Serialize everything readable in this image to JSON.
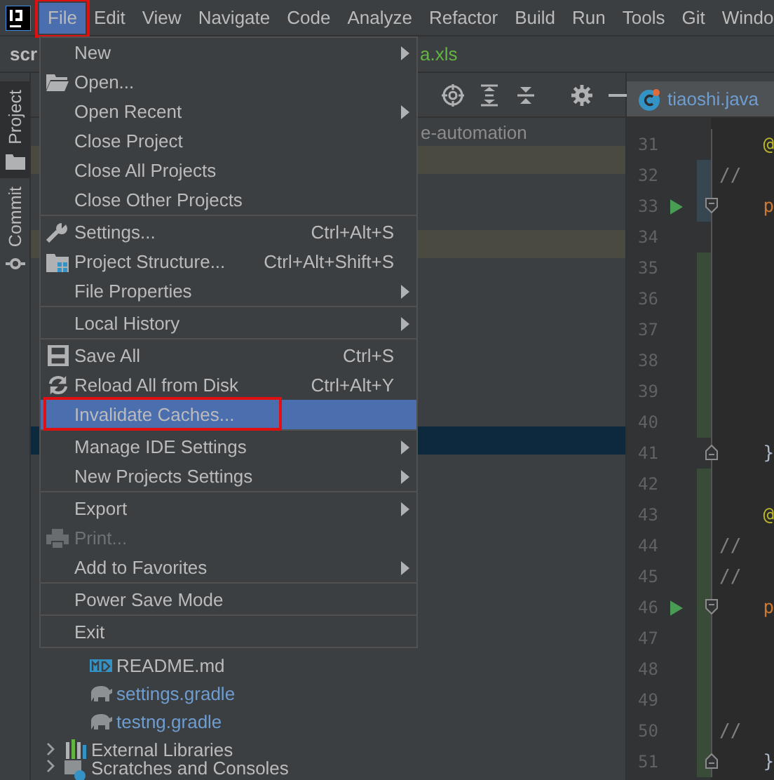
{
  "menu_bar": {
    "items": [
      {
        "label": "File",
        "selected": true,
        "boxed": true
      },
      {
        "label": "Edit",
        "selected": false,
        "boxed": false
      },
      {
        "label": "View",
        "selected": false,
        "boxed": false
      },
      {
        "label": "Navigate",
        "selected": false,
        "boxed": false
      },
      {
        "label": "Code",
        "selected": false,
        "boxed": false
      },
      {
        "label": "Analyze",
        "selected": false,
        "boxed": false
      },
      {
        "label": "Refactor",
        "selected": false,
        "boxed": false
      },
      {
        "label": "Build",
        "selected": false,
        "boxed": false
      },
      {
        "label": "Run",
        "selected": false,
        "boxed": false
      },
      {
        "label": "Tools",
        "selected": false,
        "boxed": false
      },
      {
        "label": "Git",
        "selected": false,
        "boxed": false
      },
      {
        "label": "Windo",
        "selected": false,
        "boxed": false
      }
    ]
  },
  "breadcrumb": {
    "project": "scr",
    "file": "a.xls"
  },
  "tool_window_tabs": [
    {
      "label": "Project",
      "selected": true
    },
    {
      "label": "Commit",
      "selected": false
    }
  ],
  "project_tree": {
    "rows": [
      {
        "label": "e-automation",
        "modified": false,
        "selected": false,
        "children": [
          {
            "modified": true,
            "selected": false
          },
          {
            "modified": false,
            "selected": false
          },
          {
            "modified": false,
            "selected": false
          },
          {
            "modified": true,
            "selected": false
          },
          {
            "modified": false,
            "selected": false
          },
          {
            "modified": false,
            "selected": false
          },
          {
            "modified": false,
            "selected": false
          },
          {
            "modified": false,
            "selected": false
          },
          {
            "modified": false,
            "selected": false
          },
          {
            "modified": false,
            "selected": false
          },
          {
            "modified": false,
            "selected": true
          },
          {
            "modified": false,
            "selected": false
          },
          {
            "modified": false,
            "selected": false
          },
          {
            "modified": false,
            "selected": false
          },
          {
            "modified": false,
            "selected": false
          },
          {
            "modified": false,
            "selected": false
          },
          {
            "modified": false,
            "selected": false
          },
          {
            "modified": false,
            "selected": false
          },
          {
            "label": "README.md",
            "kind": "markdown",
            "modified": false,
            "selected": false
          },
          {
            "label": "settings.gradle",
            "kind": "gradle",
            "modified": false,
            "selected": false
          },
          {
            "label": "testng.gradle",
            "kind": "gradle",
            "modified": false,
            "selected": false
          }
        ]
      },
      {
        "label": "External Libraries",
        "kind": "library",
        "expanded": false,
        "modified": false,
        "selected": false
      },
      {
        "label": "Scratches and Consoles",
        "kind": "scratches",
        "expanded": false,
        "modified": false,
        "selected": false
      }
    ]
  },
  "editor": {
    "tab": {
      "label": "tiaoshi.java"
    },
    "lines": [
      {
        "number": "31",
        "code": "    @",
        "kind": "annotation",
        "added": false,
        "modified": false,
        "run": false,
        "fold_start": false,
        "fold_end": false
      },
      {
        "number": "32",
        "code": "//",
        "kind": "comment",
        "added": false,
        "modified": true,
        "run": false,
        "fold_start": false,
        "fold_end": false
      },
      {
        "number": "33",
        "code": "    p",
        "kind": "keyword",
        "added": false,
        "modified": true,
        "run": true,
        "fold_start": true,
        "fold_end": false
      },
      {
        "number": "34",
        "added": false,
        "modified": false,
        "run": false,
        "fold_start": false,
        "fold_end": false
      },
      {
        "number": "35",
        "added": true,
        "modified": false,
        "run": false,
        "fold_start": false,
        "fold_end": false
      },
      {
        "number": "36",
        "added": true,
        "modified": false,
        "run": false,
        "fold_start": false,
        "fold_end": false
      },
      {
        "number": "37",
        "added": true,
        "modified": false,
        "run": false,
        "fold_start": false,
        "fold_end": false
      },
      {
        "number": "38",
        "added": true,
        "modified": false,
        "run": false,
        "fold_start": false,
        "fold_end": false
      },
      {
        "number": "39",
        "added": true,
        "modified": false,
        "run": false,
        "fold_start": false,
        "fold_end": false
      },
      {
        "number": "40",
        "added": true,
        "modified": false,
        "run": false,
        "fold_start": false,
        "fold_end": false
      },
      {
        "number": "41",
        "code": "    }",
        "kind": "brace",
        "added": false,
        "modified": false,
        "run": false,
        "fold_start": false,
        "fold_end": true
      },
      {
        "number": "42",
        "added": true,
        "modified": false,
        "run": false,
        "fold_start": false,
        "fold_end": false
      },
      {
        "number": "43",
        "code": "    @",
        "kind": "annotation",
        "added": true,
        "modified": false,
        "run": false,
        "fold_start": false,
        "fold_end": false
      },
      {
        "number": "44",
        "code": "//",
        "kind": "comment",
        "added": true,
        "modified": false,
        "run": false,
        "fold_start": false,
        "fold_end": false
      },
      {
        "number": "45",
        "code": "//",
        "kind": "comment",
        "added": true,
        "modified": false,
        "run": false,
        "fold_start": false,
        "fold_end": false
      },
      {
        "number": "46",
        "code": "    p",
        "kind": "keyword",
        "added": true,
        "modified": false,
        "run": true,
        "fold_start": true,
        "fold_end": false
      },
      {
        "number": "47",
        "added": true,
        "modified": false,
        "run": false,
        "fold_start": false,
        "fold_end": false
      },
      {
        "number": "48",
        "added": true,
        "modified": false,
        "run": false,
        "fold_start": false,
        "fold_end": false
      },
      {
        "number": "49",
        "added": true,
        "modified": false,
        "run": false,
        "fold_start": false,
        "fold_end": false
      },
      {
        "number": "50",
        "code": "//",
        "kind": "comment",
        "added": true,
        "modified": false,
        "run": false,
        "fold_start": false,
        "fold_end": false
      },
      {
        "number": "51",
        "code": "    }",
        "kind": "brace",
        "added": true,
        "modified": false,
        "run": false,
        "fold_start": false,
        "fold_end": true
      }
    ]
  },
  "file_menu": {
    "items": [
      {
        "kind": "item",
        "label": "New",
        "submenu": true,
        "disabled": false,
        "selected": false,
        "boxed": false
      },
      {
        "kind": "item",
        "label": "Open...",
        "submenu": false,
        "disabled": false,
        "selected": false,
        "boxed": false
      },
      {
        "kind": "item",
        "label": "Open Recent",
        "submenu": true,
        "disabled": false,
        "selected": false,
        "boxed": false
      },
      {
        "kind": "item",
        "label": "Close Project",
        "submenu": false,
        "disabled": false,
        "selected": false,
        "boxed": false
      },
      {
        "kind": "item",
        "label": "Close All Projects",
        "submenu": false,
        "disabled": false,
        "selected": false,
        "boxed": false
      },
      {
        "kind": "item",
        "label": "Close Other Projects",
        "submenu": false,
        "disabled": false,
        "selected": false,
        "boxed": false
      },
      {
        "kind": "separator"
      },
      {
        "kind": "item",
        "label": "Settings...",
        "shortcut": "Ctrl+Alt+S",
        "submenu": false,
        "disabled": false,
        "selected": false,
        "boxed": false
      },
      {
        "kind": "item",
        "label": "Project Structure...",
        "shortcut": "Ctrl+Alt+Shift+S",
        "submenu": false,
        "disabled": false,
        "selected": false,
        "boxed": false
      },
      {
        "kind": "item",
        "label": "File Properties",
        "submenu": true,
        "disabled": false,
        "selected": false,
        "boxed": false
      },
      {
        "kind": "separator"
      },
      {
        "kind": "item",
        "label": "Local History",
        "submenu": true,
        "disabled": false,
        "selected": false,
        "boxed": false
      },
      {
        "kind": "separator"
      },
      {
        "kind": "item",
        "label": "Save All",
        "shortcut": "Ctrl+S",
        "submenu": false,
        "disabled": false,
        "selected": false,
        "boxed": false
      },
      {
        "kind": "item",
        "label": "Reload All from Disk",
        "shortcut": "Ctrl+Alt+Y",
        "submenu": false,
        "disabled": false,
        "selected": false,
        "boxed": false
      },
      {
        "kind": "item",
        "label": "Invalidate Caches...",
        "submenu": false,
        "disabled": false,
        "selected": true,
        "boxed": true
      },
      {
        "kind": "separator"
      },
      {
        "kind": "item",
        "label": "Manage IDE Settings",
        "submenu": true,
        "disabled": false,
        "selected": false,
        "boxed": false
      },
      {
        "kind": "item",
        "label": "New Projects Settings",
        "submenu": true,
        "disabled": false,
        "selected": false,
        "boxed": false
      },
      {
        "kind": "separator"
      },
      {
        "kind": "item",
        "label": "Export",
        "submenu": true,
        "disabled": false,
        "selected": false,
        "boxed": false
      },
      {
        "kind": "item",
        "label": "Print...",
        "submenu": false,
        "disabled": true,
        "selected": false,
        "boxed": false
      },
      {
        "kind": "item",
        "label": "Add to Favorites",
        "submenu": true,
        "disabled": false,
        "selected": false,
        "boxed": false
      },
      {
        "kind": "separator"
      },
      {
        "kind": "item",
        "label": "Power Save Mode",
        "submenu": false,
        "disabled": false,
        "selected": false,
        "boxed": false
      },
      {
        "kind": "separator"
      },
      {
        "kind": "item",
        "label": "Exit",
        "submenu": false,
        "disabled": false,
        "selected": false,
        "boxed": false
      }
    ]
  }
}
